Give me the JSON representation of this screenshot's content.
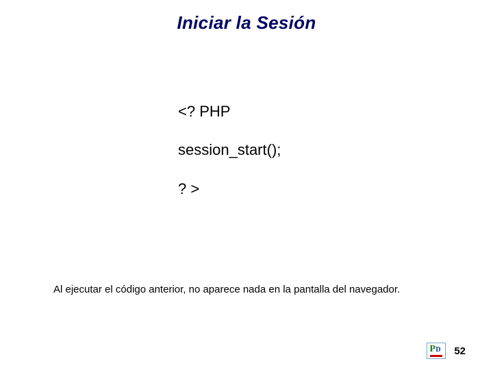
{
  "title": "Iniciar la Sesión",
  "code": {
    "line1": "<? PHP",
    "line2": "session_start();",
    "line3": "? >"
  },
  "caption": "Al ejecutar el código anterior, no aparece nada en la pantalla del navegador.",
  "footer": {
    "page_number": "52"
  }
}
